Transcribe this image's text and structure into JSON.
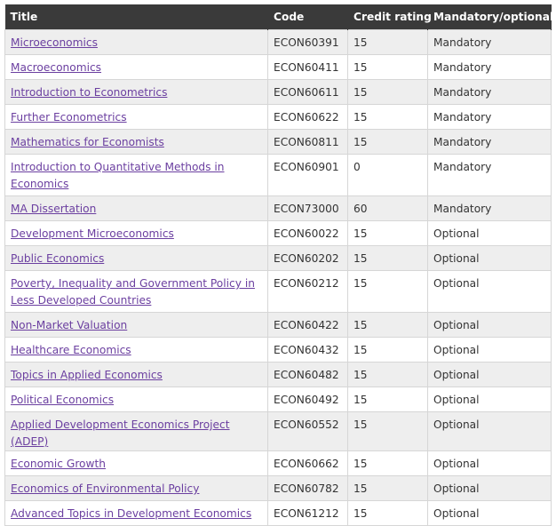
{
  "headers": {
    "title": "Title",
    "code": "Code",
    "credit": "Credit rating",
    "status": "Mandatory/optional"
  },
  "colors": {
    "header_bg": "#3a3a3a",
    "link": "#6b3fa0",
    "row_alt": "#eeeeee"
  },
  "rows": [
    {
      "title": "Microeconomics",
      "code": "ECON60391",
      "credit": "15",
      "status": "Mandatory"
    },
    {
      "title": "Macroeconomics",
      "code": "ECON60411",
      "credit": "15",
      "status": "Mandatory"
    },
    {
      "title": "Introduction to Econometrics",
      "code": "ECON60611",
      "credit": "15",
      "status": "Mandatory"
    },
    {
      "title": "Further Econometrics",
      "code": "ECON60622",
      "credit": "15",
      "status": "Mandatory"
    },
    {
      "title": "Mathematics for Economists",
      "code": "ECON60811",
      "credit": "15",
      "status": "Mandatory"
    },
    {
      "title": "Introduction to Quantitative Methods in Economics",
      "code": "ECON60901",
      "credit": "0",
      "status": "Mandatory"
    },
    {
      "title": "MA Dissertation",
      "code": "ECON73000",
      "credit": "60",
      "status": "Mandatory"
    },
    {
      "title": "Development Microeconomics",
      "code": "ECON60022",
      "credit": "15",
      "status": "Optional"
    },
    {
      "title": "Public Economics",
      "code": "ECON60202",
      "credit": "15",
      "status": "Optional"
    },
    {
      "title": "Poverty, Inequality and Government Policy in Less Developed Countries",
      "code": "ECON60212",
      "credit": "15",
      "status": "Optional"
    },
    {
      "title": "Non-Market Valuation",
      "code": "ECON60422",
      "credit": "15",
      "status": "Optional"
    },
    {
      "title": "Healthcare Economics",
      "code": "ECON60432",
      "credit": "15",
      "status": "Optional"
    },
    {
      "title": "Topics in Applied Economics",
      "code": "ECON60482",
      "credit": "15",
      "status": "Optional"
    },
    {
      "title": "Political Economics",
      "code": "ECON60492",
      "credit": "15",
      "status": "Optional"
    },
    {
      "title": "Applied Development Economics Project (ADEP)",
      "code": "ECON60552",
      "credit": "15",
      "status": "Optional"
    },
    {
      "title": "Economic Growth",
      "code": "ECON60662",
      "credit": "15",
      "status": "Optional"
    },
    {
      "title": "Economics of Environmental Policy",
      "code": "ECON60782",
      "credit": "15",
      "status": "Optional"
    },
    {
      "title": "Advanced Topics in Development Economics",
      "code": "ECON61212",
      "credit": "15",
      "status": "Optional"
    }
  ]
}
